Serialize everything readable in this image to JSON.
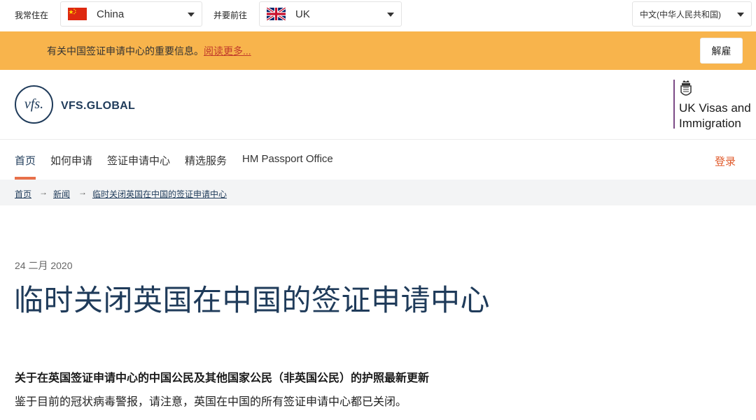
{
  "selectors": {
    "live_label": "我常住在",
    "live_value": "China",
    "going_label": "并要前往",
    "going_value": "UK",
    "language_value": "中文(中华人民共和国)"
  },
  "banner": {
    "text": "有关中国签证申请中心的重要信息。",
    "link": "阅读更多...",
    "button": "解雇",
    "color": "#f8b44c"
  },
  "header": {
    "vfs_mark": "vfs.",
    "vfs_name": "VFS.GLOBAL",
    "ukvi_line1": "UK Visas and",
    "ukvi_line2": "Immigration"
  },
  "nav": {
    "items": [
      "首页",
      "如何申请",
      "签证申请中心",
      "精选服务",
      "HM Passport Office"
    ],
    "login": "登录"
  },
  "breadcrumb": {
    "items": [
      "首页",
      "新闻",
      "临时关闭英国在中国的签证申请中心"
    ],
    "separator": "→"
  },
  "article": {
    "date": "24 二月 2020",
    "title": "临时关闭英国在中国的签证申请中心",
    "subhead": "关于在英国签证申请中心的中国公民及其他国家公民（非英国公民）的护照最新更新",
    "body": "鉴于目前的冠状病毒警报，请注意，英国在中国的所有签证申请中心都已关闭。"
  },
  "colors": {
    "brand_navy": "#1f3b5a",
    "accent_orange": "#e8704a",
    "ukvi_purple": "#7b4a86"
  }
}
